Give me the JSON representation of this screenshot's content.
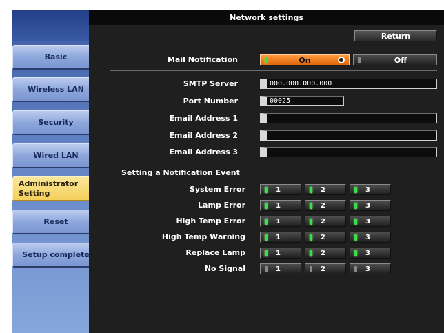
{
  "sidebar": {
    "items": [
      {
        "label": "Basic"
      },
      {
        "label": "Wireless LAN"
      },
      {
        "label": "Security"
      },
      {
        "label": "Wired LAN"
      },
      {
        "label": "Administrator Setting",
        "active": true
      },
      {
        "label": "Reset"
      },
      {
        "label": "Setup complete"
      }
    ]
  },
  "header": {
    "title": "Network settings"
  },
  "toolbar": {
    "return_label": "Return"
  },
  "mail_notification": {
    "label": "Mail Notification",
    "on_label": "On",
    "off_label": "Off",
    "selected": "On"
  },
  "smtp": {
    "label": "SMTP Server",
    "value": "000.000.000.000"
  },
  "port": {
    "label": "Port Number",
    "value": "00025"
  },
  "emails": [
    {
      "label": "Email Address 1",
      "value": ""
    },
    {
      "label": "Email Address 2",
      "value": ""
    },
    {
      "label": "Email Address 3",
      "value": ""
    }
  ],
  "events": {
    "section_title": "Setting a Notification Event",
    "rows": [
      {
        "label": "System Error",
        "checks": [
          "1",
          "2",
          "3"
        ],
        "enabled": [
          true,
          true,
          true
        ]
      },
      {
        "label": "Lamp Error",
        "checks": [
          "1",
          "2",
          "3"
        ],
        "enabled": [
          true,
          true,
          true
        ]
      },
      {
        "label": "High Temp Error",
        "checks": [
          "1",
          "2",
          "3"
        ],
        "enabled": [
          true,
          true,
          true
        ]
      },
      {
        "label": "High Temp Warning",
        "checks": [
          "1",
          "2",
          "3"
        ],
        "enabled": [
          true,
          true,
          true
        ]
      },
      {
        "label": "Replace Lamp",
        "checks": [
          "1",
          "2",
          "3"
        ],
        "enabled": [
          true,
          true,
          true
        ]
      },
      {
        "label": "No Signal",
        "checks": [
          "1",
          "2",
          "3"
        ],
        "enabled": [
          false,
          false,
          false
        ]
      }
    ]
  },
  "colors": {
    "panel": "#1f1f1f",
    "sidebar_active": "#f4cf5a",
    "sidebar_button": "#8ea8dd",
    "toggle_on": "#e0660a",
    "led_on": "#39e04a"
  }
}
